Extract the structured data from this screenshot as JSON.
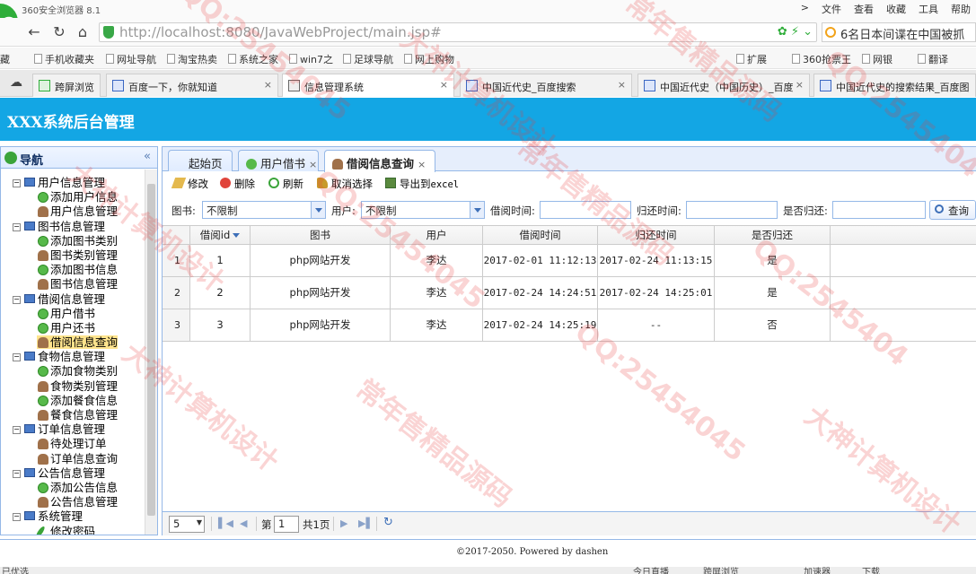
{
  "browser": {
    "app_name": "360安全浏览器 8.1",
    "menus": [
      ">",
      "文件",
      "查看",
      "收藏",
      "工具",
      "帮助"
    ],
    "url_host": "http://localhost",
    "url_path": ":8080/JavaWebProject/main.jsp#",
    "search_text": "6名日本间谍在中国被抓",
    "favorites": [
      "藏",
      "手机收藏夹",
      "网址导航",
      "淘宝热卖",
      "系统之家",
      "win7之",
      "足球导航",
      "网上购物",
      "扩展",
      "360抢票王",
      "网银",
      "翻译"
    ],
    "tabs": [
      {
        "label": "跨屏浏览"
      },
      {
        "label": "百度一下，你就知道"
      },
      {
        "label": "信息管理系统"
      },
      {
        "label": "中国近代史_百度搜索"
      },
      {
        "label": "中国近代史（中国历史）_百度"
      },
      {
        "label": "中国近代史的搜索结果_百度图"
      }
    ],
    "status_items": [
      "已优选",
      "今日直播",
      "跨屏浏览",
      "加速器",
      "下载"
    ]
  },
  "app": {
    "title": "XXX系统后台管理",
    "footer": "©2017-2050. Powered by dashen"
  },
  "sidebar": {
    "title": "导航",
    "collapse": "«",
    "groups": [
      {
        "label": "用户信息管理",
        "items": [
          {
            "label": "添加用户信息",
            "icon": "add-icon"
          },
          {
            "label": "用户信息管理",
            "icon": "user-icon"
          }
        ]
      },
      {
        "label": "图书信息管理",
        "items": [
          {
            "label": "添加图书类别",
            "icon": "add-icon"
          },
          {
            "label": "图书类别管理",
            "icon": "user-icon"
          },
          {
            "label": "添加图书信息",
            "icon": "add-icon"
          },
          {
            "label": "图书信息管理",
            "icon": "user-icon"
          }
        ]
      },
      {
        "label": "借阅信息管理",
        "items": [
          {
            "label": "用户借书",
            "icon": "add-icon"
          },
          {
            "label": "用户还书",
            "icon": "add-icon"
          },
          {
            "label": "借阅信息查询",
            "icon": "user-icon",
            "selected": true
          }
        ]
      },
      {
        "label": "食物信息管理",
        "items": [
          {
            "label": "添加食物类别",
            "icon": "add-icon"
          },
          {
            "label": "食物类别管理",
            "icon": "user-icon"
          },
          {
            "label": "添加餐食信息",
            "icon": "add-icon"
          },
          {
            "label": "餐食信息管理",
            "icon": "user-icon"
          }
        ]
      },
      {
        "label": "订单信息管理",
        "items": [
          {
            "label": "待处理订单",
            "icon": "user-icon"
          },
          {
            "label": "订单信息查询",
            "icon": "user-icon"
          }
        ]
      },
      {
        "label": "公告信息管理",
        "items": [
          {
            "label": "添加公告信息",
            "icon": "add-icon"
          },
          {
            "label": "公告信息管理",
            "icon": "user-icon"
          }
        ]
      },
      {
        "label": "系统管理",
        "items": [
          {
            "label": "修改密码",
            "icon": "pen-icon"
          }
        ]
      }
    ]
  },
  "content_tabs": [
    {
      "label": "起始页"
    },
    {
      "label": "用户借书",
      "close": "×"
    },
    {
      "label": "借阅信息查询",
      "close": "×"
    }
  ],
  "toolbar": {
    "edit": "修改",
    "delete": "删除",
    "refresh": "刷新",
    "cancel_select": "取消选择",
    "export_prefix": "导出到",
    "export_suffix": "excel"
  },
  "filters": {
    "book_label": "图书:",
    "book_value": "不限制",
    "user_label": "用户:",
    "user_value": "不限制",
    "borrow_time_label": "借阅时间:",
    "return_time_label": "归还时间:",
    "returned_label": "是否归还:",
    "query_button": "查询"
  },
  "grid": {
    "headers": [
      "借阅id",
      "图书",
      "用户",
      "借阅时间",
      "归还时间",
      "是否归还"
    ],
    "rows": [
      {
        "rn": "1",
        "id": "1",
        "book": "php网站开发",
        "user": "李达",
        "borrow": "2017-02-01 11:12:13",
        "return": "2017-02-24 11:13:15",
        "returned": "是"
      },
      {
        "rn": "2",
        "id": "2",
        "book": "php网站开发",
        "user": "李达",
        "borrow": "2017-02-24 14:24:51",
        "return": "2017-02-24 14:25:01",
        "returned": "是"
      },
      {
        "rn": "3",
        "id": "3",
        "book": "php网站开发",
        "user": "李达",
        "borrow": "2017-02-24 14:25:19",
        "return": "--",
        "returned": "否"
      }
    ]
  },
  "pager": {
    "page_size": "5",
    "page_prefix": "第",
    "page_value": "1",
    "total": "共1页"
  },
  "watermarks": [
    "QQ:25454045",
    "大神计算机设计",
    "常年售精品源码",
    "QQ:2545404",
    "大神计算机设计",
    "QQ:25454045",
    "常年售精品源码",
    "QQ:2545404",
    "大神计算机设计",
    "常年售精品源码",
    "QQ:25454045",
    "大神计算机设计"
  ],
  "colors": {
    "header_bg": "#13a6e4",
    "border": "#95b8e7",
    "selected": "#ffe48d"
  }
}
